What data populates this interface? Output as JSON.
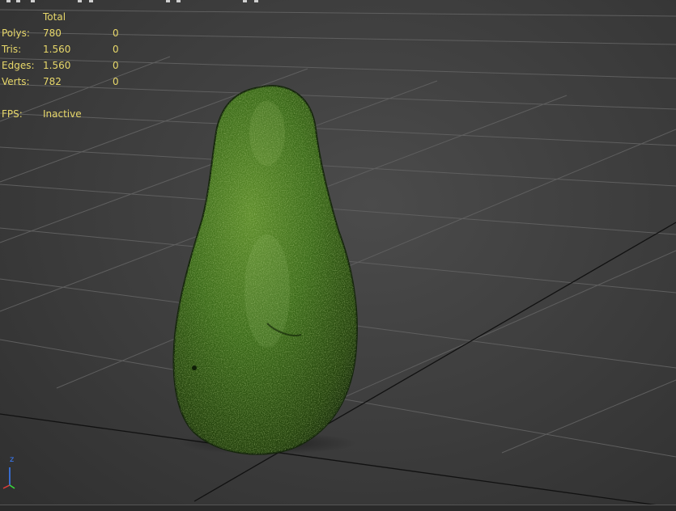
{
  "stats": {
    "header": "Total",
    "rows": [
      {
        "label": "Polys:",
        "total": "780",
        "selected": "0"
      },
      {
        "label": "Tris:",
        "total": "1.560",
        "selected": "0"
      },
      {
        "label": "Edges:",
        "total": "1.560",
        "selected": "0"
      },
      {
        "label": "Verts:",
        "total": "782",
        "selected": "0"
      }
    ]
  },
  "fps": {
    "label": "FPS:",
    "value": "Inactive"
  },
  "gizmo": {
    "axis_label": "z"
  },
  "colors": {
    "stat_text": "#e8d86a",
    "grid_line": "#5f5f5f",
    "grid_axis": "#111111",
    "avocado_base": "#2f5a14",
    "avocado_highlight": "#5e8d2c"
  },
  "icons": [
    "gizmo-z-icon",
    "avocado-model-icon"
  ]
}
